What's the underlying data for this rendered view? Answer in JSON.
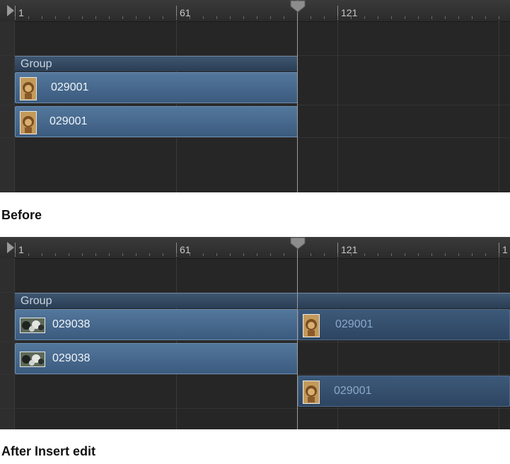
{
  "ruler": {
    "labels": [
      "1",
      "61",
      "121"
    ],
    "labels_after": [
      "1",
      "61",
      "121",
      "1"
    ]
  },
  "before": {
    "group_label": "Group",
    "clips": [
      {
        "name": "029001",
        "thumb": "lion-thumbnail"
      },
      {
        "name": "029001",
        "thumb": "lion-thumbnail"
      }
    ],
    "caption": "Before"
  },
  "after": {
    "group_label": "Group",
    "clips": [
      {
        "name": "029038",
        "thumb": "animals-thumbnail"
      },
      {
        "name": "029001",
        "thumb": "lion-thumbnail"
      },
      {
        "name": "029038",
        "thumb": "animals-thumbnail"
      },
      {
        "name": "029001",
        "thumb": "lion-thumbnail"
      }
    ],
    "caption": "After Insert edit"
  },
  "colors": {
    "timeline_bg": "#262626",
    "clip_blue": "#4a6c90",
    "group_bar": "#2f4560",
    "playhead": "#9c9c9c"
  }
}
